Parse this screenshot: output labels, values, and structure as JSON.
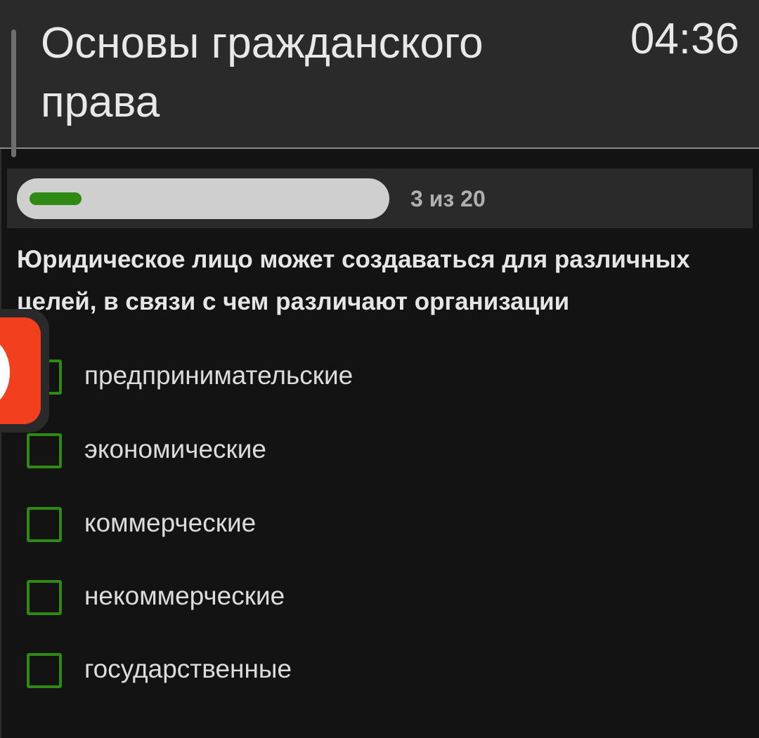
{
  "header": {
    "title": "Основы гражданского права",
    "timer": "04:36"
  },
  "progress": {
    "label": "3 из 20",
    "current": 3,
    "total": 20,
    "fill_fraction": 0.15,
    "fill_color": "#2e8a12"
  },
  "question": {
    "text": "Юридическое лицо может создаваться для различных целей, в связи с чем различают организации"
  },
  "options": [
    {
      "label": "предпринимательские",
      "checked": false
    },
    {
      "label": "экономические",
      "checked": false
    },
    {
      "label": "коммерческие",
      "checked": false
    },
    {
      "label": "некоммерческие",
      "checked": false
    },
    {
      "label": "государственные",
      "checked": false
    }
  ],
  "colors": {
    "accent": "#2e8a12",
    "background": "#131313",
    "header_background": "#2a2a2a",
    "floating_button": "#f2401e"
  },
  "floating_button": {
    "icon": "circle-icon"
  }
}
